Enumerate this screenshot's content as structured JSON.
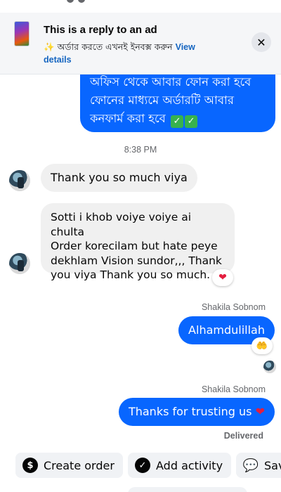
{
  "banner": {
    "title": "This is a reply to an ad",
    "spark": "✨",
    "subtitle": "অর্ডার করতে এখনই ইনবক্স করুন",
    "view_link": "View",
    "details_link": "details",
    "close_glyph": "✕"
  },
  "messages": {
    "outgoing_bengali_line1": "অফিস থেকে আবার ফোন করা হবে",
    "outgoing_bengali_line2": "ফোনের মাধ্যমে অর্ডারটি আবার",
    "outgoing_bengali_line3": "কনফার্ম করা হবে",
    "check_mark": "✓",
    "timestamp": "8:38 PM",
    "incoming_1": "Thank you so much viya",
    "incoming_2_line1": "Sotti i khob voiye voiye ai chulta",
    "incoming_2_line2": "Order korecilam but hate peye",
    "incoming_2_line3": "dekhlam Vision sundor,,, Thank",
    "incoming_2_line4": "you viya Thank you so much.",
    "reaction_heart": "❤",
    "sender_1": "Shakila Sobnom",
    "outgoing_3": "Alhamdulillah",
    "reaction_hands": "🤲",
    "sender_2": "Shakila Sobnom",
    "outgoing_4": "Thanks for trusting us",
    "outgoing_4_heart": "❤",
    "delivered": "Delivered"
  },
  "actions": {
    "create_order": "Create order",
    "create_order_icon": "$",
    "add_activity": "Add activity",
    "add_activity_icon": "✓",
    "save": "Sav",
    "save_icon": "💬"
  },
  "colors": {
    "outgoing_bubble": "#0866ff",
    "incoming_bubble": "#f0f0f0",
    "link": "#1565c0",
    "heart": "#e41e3f"
  }
}
